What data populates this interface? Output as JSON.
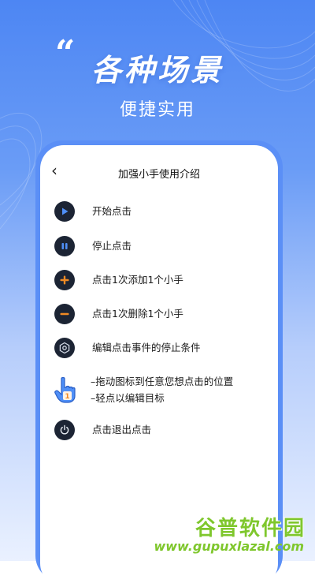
{
  "hero": {
    "quote_mark": "“",
    "title": "各种场景",
    "subtitle": "便捷实用"
  },
  "screen": {
    "back_icon": "chevron-left-icon",
    "title": "加强小手使用介绍",
    "items": [
      {
        "icon": "play-icon",
        "label": "开始点击"
      },
      {
        "icon": "pause-icon",
        "label": "停止点击"
      },
      {
        "icon": "plus-icon",
        "label": "点击1次添加1个小手"
      },
      {
        "icon": "minus-icon",
        "label": "点击1次删除1个小手"
      },
      {
        "icon": "gear-icon",
        "label": "编辑点击事件的停止条件"
      },
      {
        "icon": "hand-pointer-icon",
        "label_line1": "–拖动图标到任意您想点击的位置",
        "label_line2": "–轻点以编辑目标",
        "badge": "1"
      },
      {
        "icon": "power-icon",
        "label": "点击退出点击"
      }
    ]
  },
  "watermark": {
    "name": "谷普软件园",
    "url": "www.gupuxlazal.com"
  },
  "colors": {
    "accent_blue": "#3b82f6",
    "icon_bg": "#1c2434",
    "orange": "#f08a24",
    "watermark_green": "#7fc72d"
  }
}
